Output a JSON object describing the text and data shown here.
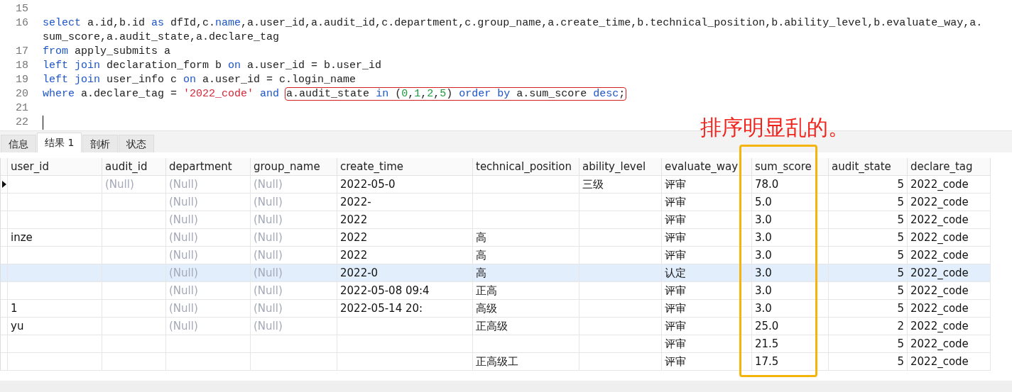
{
  "editor": {
    "lines": [
      {
        "number": "15",
        "cursor": false
      },
      {
        "number": "16",
        "cursor": false,
        "tokens": [
          {
            "kind": "keyword",
            "text": "select"
          },
          {
            "kind": "plain",
            "text": " a.id,b.id "
          },
          {
            "kind": "keyword",
            "text": "as"
          },
          {
            "kind": "plain",
            "text": " dfId,c."
          },
          {
            "kind": "keyword",
            "text": "name"
          },
          {
            "kind": "plain",
            "text": ",a.user_id,a.audit_id,c.department,c.group_name,a.create_time,b.technical_position,b.ability_level,b.evaluate_way,a.sum_score,a.audit_state,a.declare_tag"
          }
        ]
      },
      {
        "number": "17",
        "cursor": false,
        "tokens": [
          {
            "kind": "keyword",
            "text": "from"
          },
          {
            "kind": "plain",
            "text": " apply_submits a"
          }
        ]
      },
      {
        "number": "18",
        "cursor": false,
        "tokens": [
          {
            "kind": "keyword",
            "text": "left join"
          },
          {
            "kind": "plain",
            "text": " declaration_form b "
          },
          {
            "kind": "keyword",
            "text": "on"
          },
          {
            "kind": "plain",
            "text": " a.user_id = b.user_id"
          }
        ]
      },
      {
        "number": "19",
        "cursor": false,
        "tokens": [
          {
            "kind": "keyword",
            "text": "left join"
          },
          {
            "kind": "plain",
            "text": " user_info c "
          },
          {
            "kind": "keyword",
            "text": "on"
          },
          {
            "kind": "plain",
            "text": " a.user_id = c.login_name"
          }
        ]
      },
      {
        "number": "20",
        "cursor": false,
        "tokens": [
          {
            "kind": "keyword",
            "text": "where"
          },
          {
            "kind": "plain",
            "text": " a.declare_tag = "
          },
          {
            "kind": "string",
            "text": "'2022_code'"
          },
          {
            "kind": "keyword",
            "text": " and "
          },
          {
            "kind": "plain",
            "text": "a.audit_state ",
            "marked": true
          },
          {
            "kind": "keyword",
            "text": "in",
            "marked": true
          },
          {
            "kind": "plain",
            "text": " (",
            "marked": true
          },
          {
            "kind": "number",
            "text": "0",
            "marked": true
          },
          {
            "kind": "plain",
            "text": ",",
            "marked": true
          },
          {
            "kind": "number",
            "text": "1",
            "marked": true
          },
          {
            "kind": "plain",
            "text": ",",
            "marked": true
          },
          {
            "kind": "number",
            "text": "2",
            "marked": true
          },
          {
            "kind": "plain",
            "text": ",",
            "marked": true
          },
          {
            "kind": "number",
            "text": "5",
            "marked": true
          },
          {
            "kind": "plain",
            "text": ") ",
            "marked": true
          },
          {
            "kind": "keyword",
            "text": "order by",
            "marked": true
          },
          {
            "kind": "plain",
            "text": " a.sum_score ",
            "marked": true
          },
          {
            "kind": "keyword",
            "text": "desc",
            "marked": true
          },
          {
            "kind": "plain",
            "text": ";",
            "marked": true
          }
        ]
      },
      {
        "number": "21",
        "cursor": false
      },
      {
        "number": "22",
        "cursor": true
      }
    ]
  },
  "tabs": [
    {
      "label": "信息",
      "selected": false
    },
    {
      "label": "结果 1",
      "selected": true
    },
    {
      "label": "剖析",
      "selected": false
    },
    {
      "label": "状态",
      "selected": false
    }
  ],
  "annotation": {
    "text": "排序明显乱的。"
  },
  "table": {
    "columns": [
      {
        "label": "user_id",
        "kind": "text",
        "highlighted": false
      },
      {
        "label": "audit_id",
        "kind": "text",
        "highlighted": false
      },
      {
        "label": "department",
        "kind": "text",
        "highlighted": false
      },
      {
        "label": "group_name",
        "kind": "text",
        "highlighted": false
      },
      {
        "label": "create_time",
        "kind": "text",
        "highlighted": false
      },
      {
        "label": "technical_position",
        "kind": "text",
        "highlighted": false
      },
      {
        "label": "ability_level",
        "kind": "text",
        "highlighted": false
      },
      {
        "label": "evaluate_way",
        "kind": "text",
        "highlighted": false
      },
      {
        "label": "sum_score",
        "kind": "text",
        "highlighted": true
      },
      {
        "label": "audit_state",
        "kind": "number",
        "highlighted": false
      },
      {
        "label": "declare_tag",
        "kind": "text",
        "highlighted": false
      }
    ],
    "rows": [
      {
        "current": true,
        "selected": false,
        "cells": [
          null,
          {
            "text": "(Null)",
            "kind": "null"
          },
          {
            "text": "(Null)",
            "kind": "null"
          },
          {
            "text": "(Null)",
            "kind": "null"
          },
          {
            "text": "2022-05-0",
            "kind": "value"
          },
          null,
          {
            "text": "三级",
            "kind": "value"
          },
          {
            "text": "评审",
            "kind": "value"
          },
          {
            "text": "78.0",
            "kind": "value"
          },
          {
            "text": "5",
            "kind": "value"
          },
          {
            "text": "2022_code",
            "kind": "value"
          }
        ]
      },
      {
        "current": false,
        "selected": false,
        "cells": [
          null,
          null,
          {
            "text": "(Null)",
            "kind": "null"
          },
          {
            "text": "(Null)",
            "kind": "null"
          },
          {
            "text": "2022-",
            "kind": "value"
          },
          null,
          null,
          {
            "text": "评审",
            "kind": "value"
          },
          {
            "text": "5.0",
            "kind": "value"
          },
          {
            "text": "5",
            "kind": "value"
          },
          {
            "text": "2022_code",
            "kind": "value"
          }
        ]
      },
      {
        "current": false,
        "selected": false,
        "cells": [
          null,
          null,
          {
            "text": "(Null)",
            "kind": "null"
          },
          {
            "text": "(Null)",
            "kind": "null"
          },
          {
            "text": "2022",
            "kind": "value"
          },
          null,
          null,
          {
            "text": "评审",
            "kind": "value"
          },
          {
            "text": "3.0",
            "kind": "value"
          },
          {
            "text": "5",
            "kind": "value"
          },
          {
            "text": "2022_code",
            "kind": "value"
          }
        ]
      },
      {
        "current": false,
        "selected": false,
        "cells": [
          {
            "text": "inze",
            "kind": "value"
          },
          null,
          {
            "text": "(Null)",
            "kind": "null"
          },
          {
            "text": "(Null)",
            "kind": "null"
          },
          {
            "text": "2022",
            "kind": "value"
          },
          {
            "text": "高",
            "kind": "value"
          },
          null,
          {
            "text": "评审",
            "kind": "value"
          },
          {
            "text": "3.0",
            "kind": "value"
          },
          {
            "text": "5",
            "kind": "value"
          },
          {
            "text": "2022_code",
            "kind": "value"
          }
        ]
      },
      {
        "current": false,
        "selected": false,
        "cells": [
          null,
          null,
          {
            "text": "(Null)",
            "kind": "null"
          },
          {
            "text": "(Null)",
            "kind": "null"
          },
          {
            "text": "2022",
            "kind": "value"
          },
          {
            "text": "高",
            "kind": "value"
          },
          null,
          {
            "text": "评审",
            "kind": "value"
          },
          {
            "text": "3.0",
            "kind": "value"
          },
          {
            "text": "5",
            "kind": "value"
          },
          {
            "text": "2022_code",
            "kind": "value"
          }
        ]
      },
      {
        "current": false,
        "selected": true,
        "cells": [
          null,
          null,
          {
            "text": "(Null)",
            "kind": "null"
          },
          {
            "text": "(Null)",
            "kind": "null"
          },
          {
            "text": "2022-0",
            "kind": "value"
          },
          {
            "text": "高",
            "kind": "value"
          },
          null,
          {
            "text": "认定",
            "kind": "value"
          },
          {
            "text": "3.0",
            "kind": "value"
          },
          {
            "text": "5",
            "kind": "value"
          },
          {
            "text": "2022_code",
            "kind": "value"
          }
        ]
      },
      {
        "current": false,
        "selected": false,
        "cells": [
          null,
          null,
          {
            "text": "(Null)",
            "kind": "null"
          },
          {
            "text": "(Null)",
            "kind": "null"
          },
          {
            "text": "2022-05-08 09:4",
            "kind": "value"
          },
          {
            "text": "正高",
            "kind": "value"
          },
          null,
          {
            "text": "评审",
            "kind": "value"
          },
          {
            "text": "3.0",
            "kind": "value"
          },
          {
            "text": "5",
            "kind": "value"
          },
          {
            "text": "2022_code",
            "kind": "value"
          }
        ]
      },
      {
        "current": false,
        "selected": false,
        "cells": [
          {
            "text": "1",
            "kind": "value"
          },
          null,
          {
            "text": "(Null)",
            "kind": "null"
          },
          {
            "text": "(Null)",
            "kind": "null"
          },
          {
            "text": "2022-05-14 20:",
            "kind": "value"
          },
          {
            "text": "高级",
            "kind": "value"
          },
          null,
          {
            "text": "评审",
            "kind": "value"
          },
          {
            "text": "3.0",
            "kind": "value"
          },
          {
            "text": "5",
            "kind": "value"
          },
          {
            "text": "2022_code",
            "kind": "value"
          }
        ]
      },
      {
        "current": false,
        "selected": false,
        "cells": [
          {
            "text": "yu",
            "kind": "value"
          },
          null,
          {
            "text": "(Null)",
            "kind": "null"
          },
          {
            "text": "(Null)",
            "kind": "null"
          },
          null,
          {
            "text": "正高级",
            "kind": "value"
          },
          null,
          {
            "text": "评审",
            "kind": "value"
          },
          {
            "text": "25.0",
            "kind": "value"
          },
          {
            "text": "2",
            "kind": "value"
          },
          {
            "text": "2022_code",
            "kind": "value"
          }
        ]
      },
      {
        "current": false,
        "selected": false,
        "cells": [
          null,
          null,
          null,
          null,
          null,
          null,
          null,
          {
            "text": "评审",
            "kind": "value"
          },
          {
            "text": "21.5",
            "kind": "value"
          },
          {
            "text": "5",
            "kind": "value"
          },
          {
            "text": "2022_code",
            "kind": "value"
          }
        ]
      },
      {
        "current": false,
        "selected": false,
        "cells": [
          null,
          null,
          null,
          null,
          null,
          {
            "text": "正高级工",
            "kind": "value"
          },
          null,
          {
            "text": "评审",
            "kind": "value"
          },
          {
            "text": "17.5",
            "kind": "value"
          },
          {
            "text": "5",
            "kind": "value"
          },
          {
            "text": "2022_code",
            "kind": "value"
          }
        ]
      }
    ]
  }
}
